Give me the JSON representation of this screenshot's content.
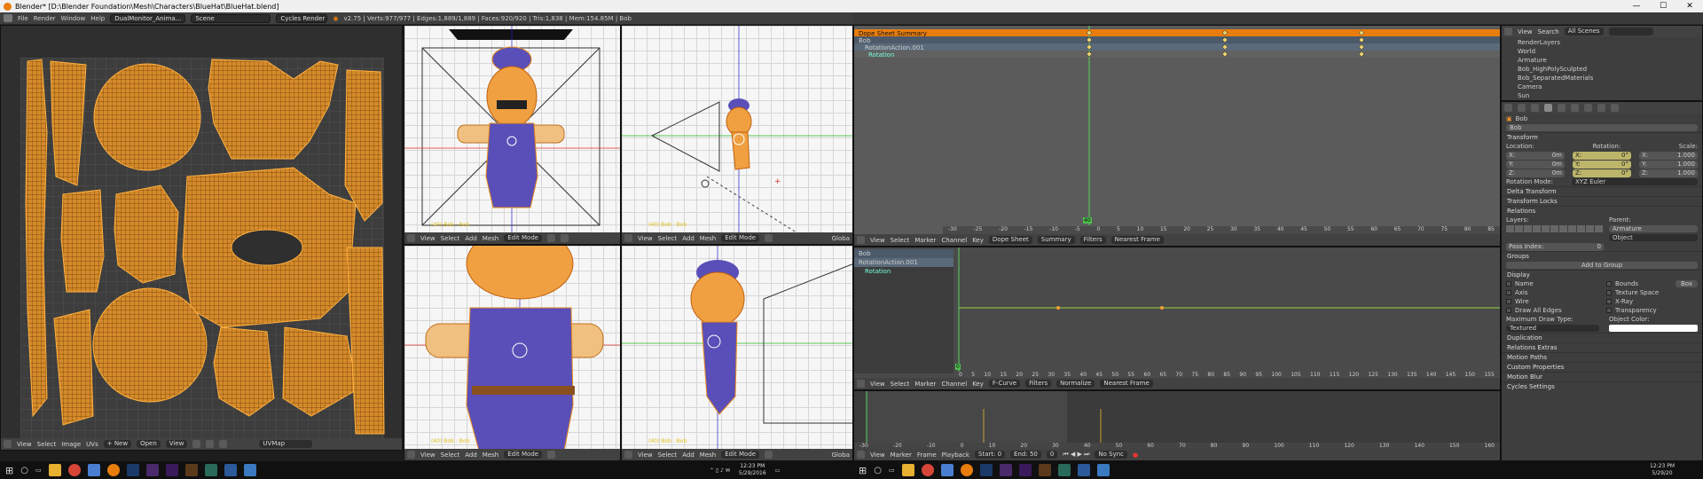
{
  "window": {
    "title": "Blender* [D:\\Blender Foundation\\Mesh\\Characters\\BlueHat\\BlueHat.blend]",
    "min": "—",
    "max": "☐",
    "close": "✕"
  },
  "info": {
    "menu": [
      "File",
      "Render",
      "Window",
      "Help"
    ],
    "layout": "DualMonitor_Anima...",
    "scene": "Scene",
    "engine": "Cycles Render",
    "stats": "v2.75 | Verts:977/977 | Edges:1,889/1,889 | Faces:920/920 | Tris:1,838 | Mem:154.85M | Bob"
  },
  "uv": {
    "header": [
      "View",
      "Select",
      "Image",
      "UVs"
    ],
    "new": "+ New",
    "open": "Open",
    "viewbtn": "View",
    "uvmap": "UVMap"
  },
  "viewports": [
    {
      "label": "(40) Bob : Bob",
      "header": [
        "View",
        "Select",
        "Add",
        "Mesh"
      ],
      "mode": "Edit Mode"
    },
    {
      "label": "(40) Bob : Bob",
      "header": [
        "View",
        "Select",
        "Add",
        "Mesh"
      ],
      "mode": "Edit Mode",
      "global": "Globa"
    },
    {
      "label": "(40) Bob : Bob",
      "header": [
        "View",
        "Select",
        "Add",
        "Mesh"
      ],
      "mode": "Edit Mode"
    },
    {
      "label": "(40) Bob : Bob",
      "header": [
        "View",
        "Select",
        "Add",
        "Mesh"
      ],
      "mode": "Edit Mode",
      "global": "Globa"
    }
  ],
  "dopesheet": {
    "channels": [
      "Dope Sheet Summary",
      "Bob",
      "RotationAction.001",
      "Rotation"
    ],
    "header": [
      "View",
      "Select",
      "Marker",
      "Channel",
      "Key"
    ],
    "mode": "Dope Sheet",
    "summary": "Summary",
    "filters": "Filters",
    "snap": "Nearest Frame",
    "ticks": [
      "-30",
      "-25",
      "-20",
      "-15",
      "-10",
      "-5",
      "0",
      "5",
      "10",
      "15",
      "20",
      "25",
      "30",
      "35",
      "40",
      "45",
      "50",
      "55",
      "60",
      "65",
      "70",
      "75",
      "80",
      "85"
    ],
    "frame": "40"
  },
  "graph": {
    "channels": [
      "Bob",
      "RotationAction.001",
      "Rotation"
    ],
    "header": [
      "View",
      "Select",
      "Marker",
      "Channel",
      "Key"
    ],
    "mode": "F-Curve",
    "filters": "Filters",
    "normalize": "Normalize",
    "snap": "Nearest Frame",
    "ticks": [
      "0",
      "5",
      "10",
      "15",
      "20",
      "25",
      "30",
      "35",
      "40",
      "45",
      "50",
      "55",
      "60",
      "65",
      "70",
      "75",
      "80",
      "85",
      "90",
      "95",
      "100",
      "105",
      "110",
      "115",
      "120",
      "125",
      "130",
      "135",
      "140",
      "145",
      "150",
      "155"
    ],
    "frame": "0"
  },
  "timeline": {
    "header": [
      "View",
      "Marker",
      "Frame",
      "Playback"
    ],
    "start": "Start:",
    "start_val": "0",
    "end": "End:",
    "end_val": "50",
    "cur": "0",
    "sync": "No Sync",
    "ticks": [
      "-30",
      "-20",
      "-10",
      "0",
      "10",
      "20",
      "30",
      "40",
      "50",
      "60",
      "70",
      "80",
      "90",
      "100",
      "110",
      "120",
      "130",
      "140",
      "150",
      "160"
    ]
  },
  "outliner": {
    "header": [
      "View",
      "Search",
      "All Scenes"
    ],
    "items": [
      "RenderLayers",
      "World",
      "Armature",
      "Bob_HighPolySculpted",
      "Bob_SeparatedMaterials",
      "Camera",
      "Sun"
    ]
  },
  "properties": {
    "object": "Bob",
    "name": "Bob",
    "transform": "Transform",
    "location": "Location:",
    "rotation": "Rotation:",
    "scale": "Scale:",
    "loc": [
      "X:",
      "0m",
      "Y:",
      "0m",
      "Z:",
      "0m"
    ],
    "rot": [
      "X:",
      "0°",
      "Y:",
      "0°",
      "Z:",
      "0°"
    ],
    "scl": [
      "X:",
      "1.000",
      "Y:",
      "1.000",
      "Z:",
      "1.000"
    ],
    "rotmode_label": "Rotation Mode:",
    "rotmode": "XYZ Euler",
    "delta": "Delta Transform",
    "locks": "Transform Locks",
    "relations": "Relations",
    "layers": "Layers:",
    "parent": "Parent:",
    "parent_val": "Armature",
    "parent_type": "Object",
    "pass": "Pass Index:",
    "pass_val": "0",
    "groups": "Groups",
    "addgroup": "Add to Group",
    "display": "Display",
    "disp_left": [
      "Name",
      "Axis",
      "Wire",
      "Draw All Edges"
    ],
    "disp_right": [
      "Bounds",
      "Texture Space",
      "X-Ray",
      "Transparency"
    ],
    "bounds": "Box",
    "maxdraw": "Maximum Draw Type:",
    "maxdraw_val": "Textured",
    "objcolor": "Object Color:",
    "sections": [
      "Duplication",
      "Relations Extras",
      "Motion Paths",
      "Custom Properties",
      "Motion Blur",
      "Cycles Settings"
    ]
  },
  "taskbar": {
    "time": "12:23 PM",
    "date": "5/29/2016",
    "time2": "12:23 PM",
    "date2": "5/29/20"
  },
  "colors": {
    "accent": "#e8891a",
    "bluehat": "#5a4fb8",
    "skin": "#f0a040"
  }
}
